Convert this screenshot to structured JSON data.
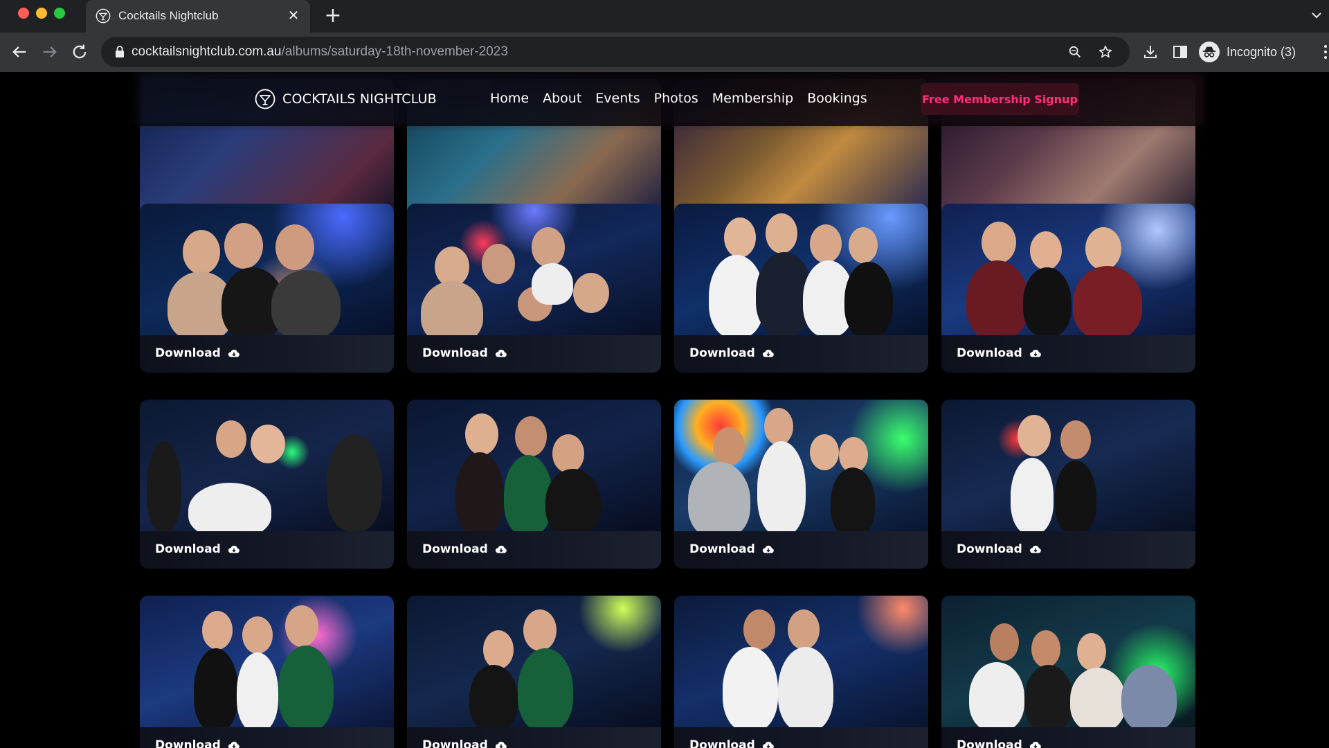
{
  "browser": {
    "tab_title": "Cocktails Nightclub",
    "url_host": "cocktailsnightclub.com.au",
    "url_path": "/albums/saturday-18th-november-2023",
    "profile_label": "Incognito (3)"
  },
  "site": {
    "brand": "COCKTAILS NIGHTCLUB",
    "nav": [
      "Home",
      "About",
      "Events",
      "Photos",
      "Membership",
      "Bookings"
    ],
    "cta_label": "Free Membership Signup",
    "cta_color": "#ff2f7b"
  },
  "gallery": {
    "download_label": "Download",
    "download_icon": "cloud-download-icon",
    "rows_visible": 4,
    "columns": 4
  }
}
